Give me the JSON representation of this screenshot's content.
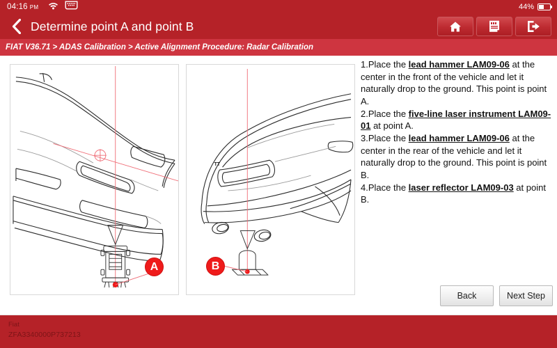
{
  "statusbar": {
    "time": "04:16",
    "ampm": "PM",
    "wifi_icon": "wifi-icon",
    "vci_icon": "vci-connector-icon",
    "battery_percent": "44%",
    "battery_level": 44
  },
  "titlebar": {
    "back_icon": "back-chevron-icon",
    "title": "Determine point A and point B",
    "actions": [
      {
        "name": "home-button",
        "icon": "home-icon",
        "label": "Home"
      },
      {
        "name": "adas-report-button",
        "icon": "adas-report-icon",
        "label": "ADAS"
      },
      {
        "name": "exit-button",
        "icon": "exit-icon",
        "label": "Exit"
      }
    ]
  },
  "breadcrumb": {
    "text": "FIAT V36.71 > ADAS Calibration > Active Alignment Procedure: Radar Calibration"
  },
  "diagrams": [
    {
      "name": "front-vehicle-diagram",
      "marker": "A",
      "caption": "Front of vehicle with lead hammer and five-line laser instrument at point A"
    },
    {
      "name": "rear-vehicle-diagram",
      "marker": "B",
      "caption": "Rear of vehicle with lead hammer and laser reflector at point B"
    }
  ],
  "instructions": [
    {
      "number": "1.",
      "pre": "Place the ",
      "emphasis": "lead hammer LAM09-06",
      "post": " at the center in the front of the vehicle and let it naturally drop to the ground. This point is point A."
    },
    {
      "number": "2.",
      "pre": "Place the ",
      "emphasis": "five-line laser instrument LAM09-01",
      "post": " at point A."
    },
    {
      "number": "3.",
      "pre": "Place the ",
      "emphasis": "lead hammer LAM09-06",
      "post": " at the center in the rear of the vehicle and let it naturally drop to the ground. This point is point B."
    },
    {
      "number": "4.",
      "pre": "Place the ",
      "emphasis": "laser reflector LAM09-03",
      "post": " at point B."
    }
  ],
  "buttons": {
    "back": "Back",
    "next": "Next Step"
  },
  "footer": {
    "make": "Fiat",
    "vin": "ZFA3340000P737213"
  },
  "colors": {
    "brand_red": "#b52228",
    "breadcrumb_red": "#ce3540",
    "marker_red": "#ef1b1b",
    "laser_red": "#e8707a",
    "footer_text": "#7d1417"
  }
}
